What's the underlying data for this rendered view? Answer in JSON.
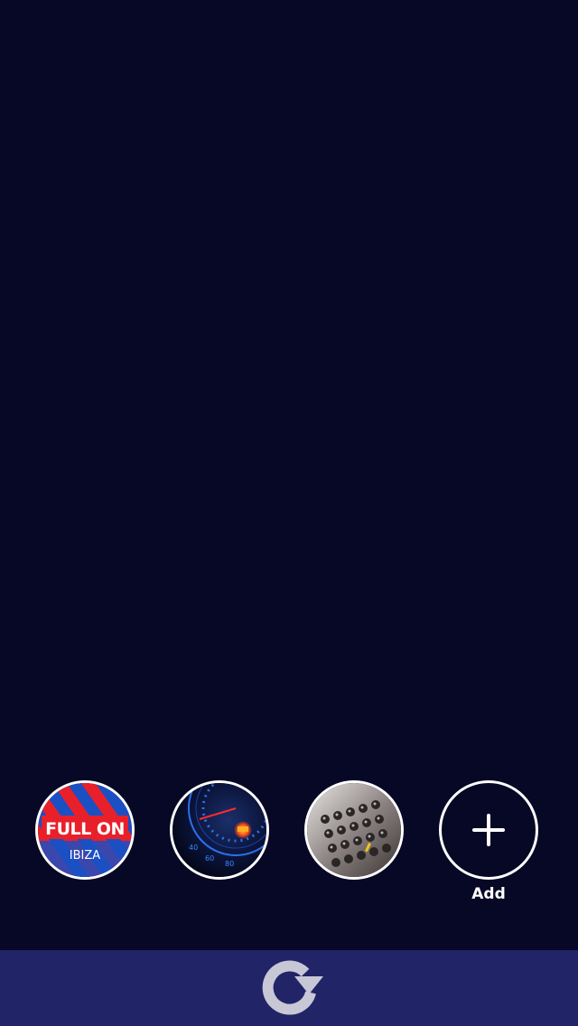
{
  "channels": [
    {
      "name": "fullon-ibiza",
      "logo_text": "FULL ON",
      "logo_subtext": "IBIZA",
      "colors": [
        "#e8202a",
        "#1b4fc4"
      ]
    },
    {
      "name": "speedometer",
      "icon": "speedometer-image"
    },
    {
      "name": "mixer",
      "icon": "audio-mixer-image"
    }
  ],
  "add_button": {
    "label": "Add",
    "icon": "plus-icon"
  },
  "bottom_bar": {
    "logo": "app-logo-icon"
  },
  "colors": {
    "background": "#070726",
    "bottom_bar": "#212467",
    "logo": "#c7c7d6",
    "ring": "#ffffff"
  }
}
